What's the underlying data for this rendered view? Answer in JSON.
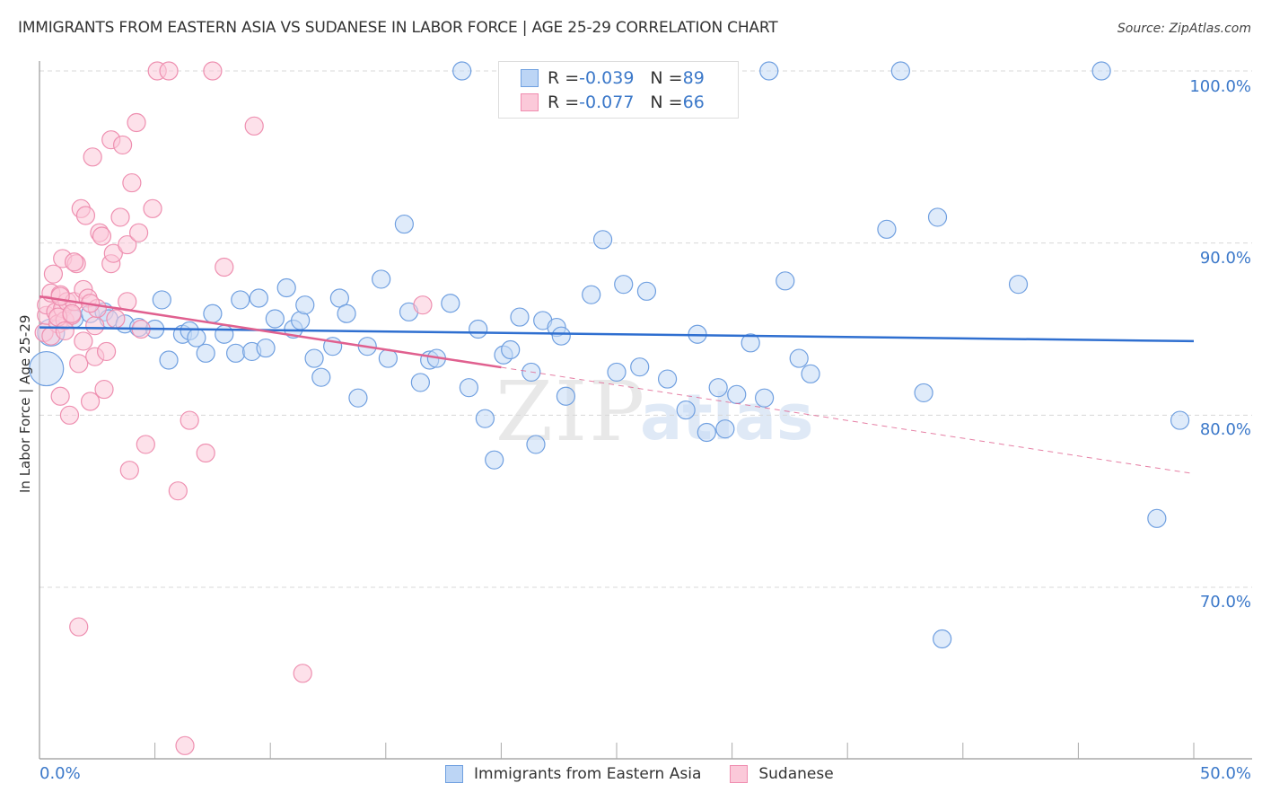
{
  "header": {
    "title": "IMMIGRANTS FROM EASTERN ASIA VS SUDANESE IN LABOR FORCE | AGE 25-29 CORRELATION CHART",
    "source": "Source: ZipAtlas.com"
  },
  "watermark": {
    "zip": "ZIP",
    "atlas": "atlas"
  },
  "legend": {
    "rows": [
      {
        "r_label": "R = ",
        "r_value": "-0.039",
        "n_label": "N = ",
        "n_value": "89"
      },
      {
        "r_label": "R = ",
        "r_value": "-0.077",
        "n_label": "N = ",
        "n_value": "66"
      }
    ]
  },
  "chart_data": {
    "type": "scatter",
    "title": "IMMIGRANTS FROM EASTERN ASIA VS SUDANESE IN LABOR FORCE | AGE 25-29 CORRELATION CHART",
    "xlabel": "",
    "ylabel": "In Labor Force | Age 25-29",
    "xlim": [
      0,
      50
    ],
    "ylim": [
      60.5,
      101
    ],
    "x_tick_labels": [
      "0.0%",
      "50.0%"
    ],
    "y_ticks": [
      100,
      90,
      80,
      70
    ],
    "y_tick_labels": [
      "100.0%",
      "90.0%",
      "80.0%",
      "70.0%"
    ],
    "grid": true,
    "legend_position": "bottom-center",
    "colors": {
      "eastern_asia": "#6fa0e0",
      "sudanese": "#f08db0",
      "eastern_asia_line": "#2f6fd0",
      "sudanese_line": "#e0608f"
    },
    "series": [
      {
        "name": "Immigrants from Eastern Asia",
        "R": -0.039,
        "N": 89,
        "trend": {
          "x": [
            0,
            50
          ],
          "y": [
            85.1,
            84.3
          ]
        },
        "points": [
          [
            0.3,
            82.7,
            3
          ],
          [
            0.5,
            84.8,
            2
          ],
          [
            1.5,
            85.6,
            1
          ],
          [
            2.2,
            85.9,
            1
          ],
          [
            2.8,
            86.0,
            1
          ],
          [
            3.0,
            85.6,
            1
          ],
          [
            3.7,
            85.3,
            1
          ],
          [
            4.3,
            85.1,
            1
          ],
          [
            5.0,
            85.0,
            1
          ],
          [
            5.3,
            86.7,
            1
          ],
          [
            5.6,
            83.2,
            1
          ],
          [
            6.2,
            84.7,
            1
          ],
          [
            6.5,
            84.9,
            1
          ],
          [
            6.8,
            84.5,
            1
          ],
          [
            7.2,
            83.6,
            1
          ],
          [
            7.5,
            85.9,
            1
          ],
          [
            8.0,
            84.7,
            1
          ],
          [
            8.5,
            83.6,
            1
          ],
          [
            8.7,
            86.7,
            1
          ],
          [
            9.2,
            83.7,
            1
          ],
          [
            9.5,
            86.8,
            1
          ],
          [
            9.8,
            83.9,
            1
          ],
          [
            10.2,
            85.6,
            1
          ],
          [
            10.7,
            87.4,
            1
          ],
          [
            11.0,
            85.0,
            1
          ],
          [
            11.3,
            85.5,
            1
          ],
          [
            11.5,
            86.4,
            1
          ],
          [
            11.9,
            83.3,
            1
          ],
          [
            12.2,
            82.2,
            1
          ],
          [
            12.7,
            84.0,
            1
          ],
          [
            13.0,
            86.8,
            1
          ],
          [
            13.3,
            85.9,
            1
          ],
          [
            13.8,
            81.0,
            1
          ],
          [
            14.2,
            84.0,
            1
          ],
          [
            14.8,
            87.9,
            1
          ],
          [
            15.1,
            83.3,
            1
          ],
          [
            15.8,
            91.1,
            1
          ],
          [
            16.0,
            86.0,
            1
          ],
          [
            16.5,
            81.9,
            1
          ],
          [
            16.9,
            83.2,
            1
          ],
          [
            17.2,
            83.3,
            1
          ],
          [
            17.8,
            86.5,
            1
          ],
          [
            18.3,
            100.0,
            1
          ],
          [
            18.6,
            81.6,
            1
          ],
          [
            19.0,
            85.0,
            1
          ],
          [
            19.3,
            79.8,
            1
          ],
          [
            19.7,
            77.4,
            1
          ],
          [
            20.1,
            83.5,
            1
          ],
          [
            20.4,
            83.8,
            1
          ],
          [
            20.8,
            85.7,
            1
          ],
          [
            21.3,
            82.5,
            1
          ],
          [
            21.5,
            78.3,
            1
          ],
          [
            21.8,
            85.5,
            1
          ],
          [
            22.4,
            85.1,
            1
          ],
          [
            22.6,
            84.6,
            1
          ],
          [
            22.8,
            81.1,
            1
          ],
          [
            23.9,
            87.0,
            1
          ],
          [
            24.4,
            90.2,
            1
          ],
          [
            25.0,
            82.5,
            1
          ],
          [
            25.3,
            87.6,
            1
          ],
          [
            26.0,
            82.8,
            1
          ],
          [
            26.3,
            87.2,
            1
          ],
          [
            27.2,
            82.1,
            1
          ],
          [
            28.0,
            80.3,
            1
          ],
          [
            28.5,
            84.7,
            1
          ],
          [
            28.9,
            79.0,
            1
          ],
          [
            29.4,
            81.6,
            1
          ],
          [
            29.7,
            79.2,
            1
          ],
          [
            30.2,
            81.2,
            1
          ],
          [
            30.8,
            84.2,
            1
          ],
          [
            31.4,
            81.0,
            1
          ],
          [
            31.6,
            100.0,
            1
          ],
          [
            32.3,
            87.8,
            1
          ],
          [
            32.9,
            83.3,
            1
          ],
          [
            33.4,
            82.4,
            1
          ],
          [
            36.7,
            90.8,
            1
          ],
          [
            37.3,
            100.0,
            1
          ],
          [
            38.3,
            81.3,
            1
          ],
          [
            38.9,
            91.5,
            1
          ],
          [
            39.1,
            67.0,
            1
          ],
          [
            42.4,
            87.6,
            1
          ],
          [
            46.0,
            100.0,
            1
          ],
          [
            48.4,
            74.0,
            1
          ],
          [
            49.4,
            79.7,
            1
          ]
        ]
      },
      {
        "name": "Sudanese",
        "R": -0.077,
        "N": 66,
        "trend": {
          "x": [
            0,
            50
          ],
          "y": [
            86.9,
            76.6
          ],
          "solid_until_x": 20
        },
        "points": [
          [
            0.2,
            84.8,
            1
          ],
          [
            0.3,
            85.8,
            1
          ],
          [
            0.3,
            86.4,
            1
          ],
          [
            0.5,
            87.1,
            1
          ],
          [
            0.6,
            88.2,
            1
          ],
          [
            0.7,
            86.0,
            1
          ],
          [
            0.8,
            85.3,
            1
          ],
          [
            0.9,
            81.1,
            1
          ],
          [
            0.9,
            87.0,
            1
          ],
          [
            1.0,
            86.2,
            1
          ],
          [
            1.0,
            89.1,
            1
          ],
          [
            1.1,
            85.5,
            1
          ],
          [
            1.2,
            86.6,
            1
          ],
          [
            1.3,
            80.0,
            1
          ],
          [
            1.4,
            85.8,
            1
          ],
          [
            1.5,
            86.6,
            1
          ],
          [
            1.6,
            88.8,
            1
          ],
          [
            1.7,
            83.0,
            1
          ],
          [
            1.8,
            92.0,
            1
          ],
          [
            1.9,
            84.3,
            1
          ],
          [
            1.9,
            87.3,
            1
          ],
          [
            2.0,
            91.6,
            1
          ],
          [
            2.1,
            86.8,
            1
          ],
          [
            2.2,
            80.8,
            1
          ],
          [
            2.3,
            95.0,
            1
          ],
          [
            2.4,
            85.2,
            1
          ],
          [
            2.4,
            83.4,
            1
          ],
          [
            2.6,
            90.6,
            1
          ],
          [
            2.7,
            90.4,
            1
          ],
          [
            2.8,
            81.5,
            1
          ],
          [
            2.9,
            83.7,
            1
          ],
          [
            3.1,
            88.8,
            1
          ],
          [
            3.1,
            96.0,
            1
          ],
          [
            3.2,
            89.4,
            1
          ],
          [
            3.3,
            85.6,
            1
          ],
          [
            3.5,
            91.5,
            1
          ],
          [
            3.6,
            95.7,
            1
          ],
          [
            3.8,
            89.9,
            1
          ],
          [
            3.8,
            86.6,
            1
          ],
          [
            3.9,
            76.8,
            1
          ],
          [
            4.0,
            93.5,
            1
          ],
          [
            4.2,
            97.0,
            1
          ],
          [
            4.3,
            90.6,
            1
          ],
          [
            4.4,
            85.0,
            1
          ],
          [
            4.6,
            78.3,
            1
          ],
          [
            4.9,
            92.0,
            1
          ],
          [
            5.1,
            100.0,
            1
          ],
          [
            5.6,
            100.0,
            1
          ],
          [
            6.0,
            75.6,
            1
          ],
          [
            6.3,
            60.8,
            1
          ],
          [
            6.5,
            79.7,
            1
          ],
          [
            7.2,
            77.8,
            1
          ],
          [
            7.5,
            100.0,
            1
          ],
          [
            8.0,
            88.6,
            1
          ],
          [
            9.3,
            96.8,
            1
          ],
          [
            1.7,
            67.7,
            1
          ],
          [
            11.4,
            65.0,
            1
          ],
          [
            16.6,
            86.4,
            1
          ],
          [
            0.5,
            84.6,
            1
          ],
          [
            0.8,
            85.7,
            1
          ],
          [
            1.4,
            85.9,
            1
          ],
          [
            2.5,
            86.2,
            1
          ],
          [
            0.9,
            86.9,
            1
          ],
          [
            1.5,
            88.9,
            1
          ],
          [
            2.2,
            86.5,
            1
          ],
          [
            1.1,
            84.9,
            1
          ]
        ]
      }
    ]
  },
  "bottom_legend": [
    {
      "label": "Immigrants from Eastern Asia"
    },
    {
      "label": "Sudanese"
    }
  ]
}
